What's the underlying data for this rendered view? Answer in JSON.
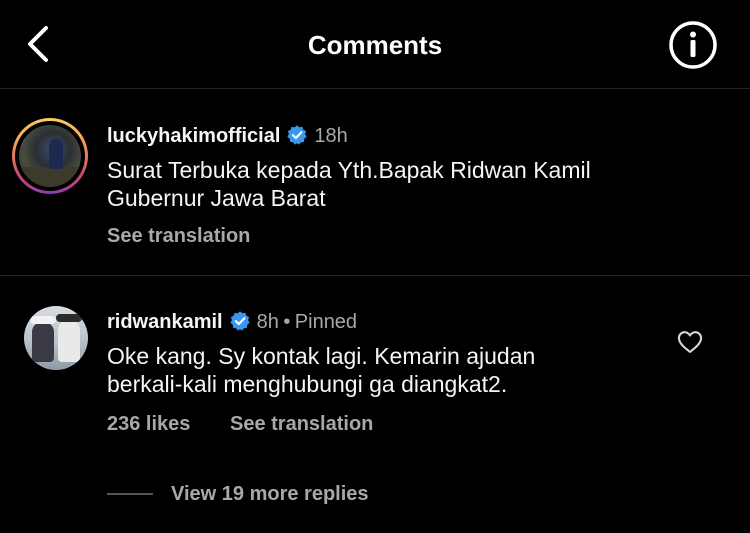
{
  "header": {
    "title": "Comments",
    "back_icon": "chevron-left-icon",
    "info_icon": "info-icon"
  },
  "caption": {
    "username": "luckyhakimofficial",
    "verified": true,
    "time": "18h",
    "line1": "Surat Terbuka kepada Yth.Bapak Ridwan Kamil",
    "line2": "Gubernur Jawa Barat",
    "see_translation": "See translation"
  },
  "comment": {
    "username": "ridwankamil",
    "verified": true,
    "time": "8h",
    "separator": "•",
    "pinned": "Pinned",
    "line1": "Oke kang. Sy kontak lagi. Kemarin ajudan",
    "line2": "berkali-kali menghubungi ga diangkat2.",
    "likes": "236 likes",
    "see_translation": "See translation",
    "view_replies": "View 19 more replies"
  },
  "colors": {
    "background": "#000000",
    "verified": "#3897f0",
    "muted": "#a8a8a8",
    "divider": "#262626"
  }
}
